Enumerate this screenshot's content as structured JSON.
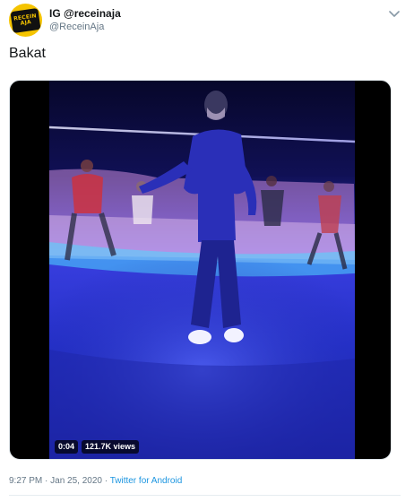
{
  "tweet": {
    "author": {
      "display_name": "IG @receinaja",
      "handle": "@ReceinAja",
      "avatar_text_top": "RECEIN",
      "avatar_text_bottom": "AJA",
      "avatar_color": "#f5c400"
    },
    "menu_icon": "chevron-down-icon",
    "text": "Bakat",
    "media": {
      "type": "video",
      "duration": "0:04",
      "views": "121.7K views"
    },
    "meta": {
      "time": "9:27 PM",
      "separator": " · ",
      "date": "Jan 25, 2020",
      "source": "Twitter for Android"
    }
  }
}
